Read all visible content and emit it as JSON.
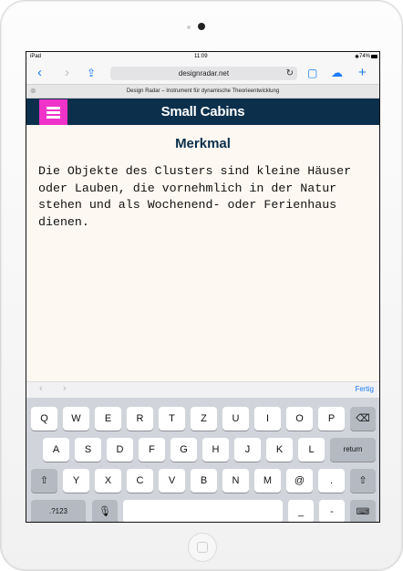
{
  "status": {
    "device": "iPad",
    "time": "11:09",
    "battery": "74%"
  },
  "browser": {
    "url": "designradar.net",
    "tab_title": "Design Radar – Instrument für dynamische Theorieentwicklung"
  },
  "app": {
    "title": "Small Cabins"
  },
  "content": {
    "heading": "Merkmal",
    "body": "Die Objekte des Clusters sind kleine Häuser oder Lauben, die vornehmlich in der Natur stehen und als Wochenend- oder Ferienhaus dienen."
  },
  "accessory": {
    "done_label": "Fertig"
  },
  "keyboard": {
    "row1": [
      "Q",
      "W",
      "E",
      "R",
      "T",
      "Z",
      "U",
      "I",
      "O",
      "P"
    ],
    "row2": [
      "A",
      "S",
      "D",
      "F",
      "G",
      "H",
      "J",
      "K",
      "L"
    ],
    "row3": [
      "Y",
      "X",
      "C",
      "V",
      "B",
      "N",
      "M",
      "@",
      "."
    ],
    "return_label": "return",
    "numbers_label": ".?123",
    "underscore_label": "_",
    "dash_label": "-"
  }
}
